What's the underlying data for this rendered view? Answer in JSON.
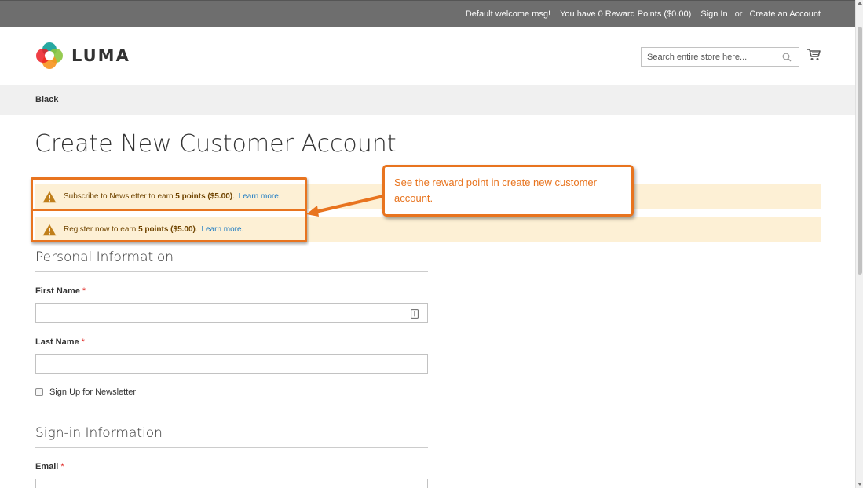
{
  "topbar": {
    "welcome": "Default welcome msg!",
    "reward_points": "You have 0 Reward Points ($0.00)",
    "sign_in": "Sign In",
    "or": "or",
    "create_account": "Create an Account"
  },
  "header": {
    "logo_text": "LUMA",
    "search_placeholder": "Search entire store here...",
    "search_icon": "search-icon",
    "cart_icon": "cart-icon"
  },
  "breadcrumb": {
    "current": "Black"
  },
  "page": {
    "title": "Create New Customer Account"
  },
  "notices": [
    {
      "prefix": "Subscribe to Newsletter to earn ",
      "points": "5 points ($5.00)",
      "suffix": ".",
      "link": "Learn more."
    },
    {
      "prefix": "Register now to earn ",
      "points": "5 points ($5.00)",
      "suffix": ".",
      "link": "Learn more."
    }
  ],
  "annotation": {
    "text": "See the reward point in create new customer account."
  },
  "form": {
    "personal_section": "Personal Information",
    "first_name_label": "First Name",
    "first_name_value": "",
    "last_name_label": "Last Name",
    "last_name_value": "",
    "required_mark": "*",
    "newsletter_label": "Sign Up for Newsletter",
    "newsletter_checked": false,
    "signin_section": "Sign-in Information",
    "email_label": "Email"
  },
  "colors": {
    "topbar_bg": "#6e6e6e",
    "notice_bg": "#fdf0d5",
    "accent_orange": "#e8741f",
    "link_blue": "#1979c3",
    "required_red": "#e02b27"
  }
}
